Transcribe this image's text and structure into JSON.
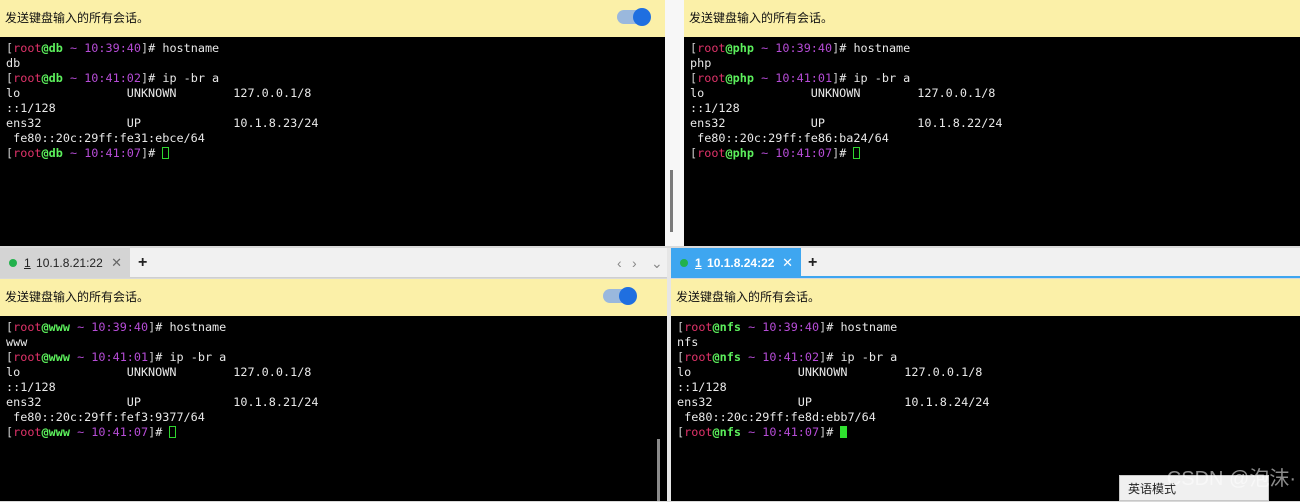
{
  "broadcast_label": "发送键盘输入的所有会话。",
  "tabs_left": {
    "num": "1",
    "label": "10.1.8.21:22",
    "close": "✕",
    "add": "+",
    "prev": "‹",
    "next": "›",
    "menu": "⌄"
  },
  "tabs_right": {
    "num": "1",
    "label": "10.1.8.24:22",
    "close": "✕",
    "add": "+"
  },
  "panes": {
    "db": {
      "host": "db",
      "t1": "10:39:40",
      "t2": "10:41:02",
      "t3": "10:41:07",
      "cmd1": "hostname",
      "out1": "db",
      "cmd2": "ip -br a",
      "lo": "lo               UNKNOWN        127.0.0.1/8",
      "lo6": "::1/128",
      "eth": "ens32            UP             10.1.8.23/24",
      "eth6": " fe80::20c:29ff:fe31:ebce/64"
    },
    "php": {
      "host": "php",
      "t1": "10:39:40",
      "t2": "10:41:01",
      "t3": "10:41:07",
      "cmd1": "hostname",
      "out1": "php",
      "cmd2": "ip -br a",
      "lo": "lo               UNKNOWN        127.0.0.1/8",
      "lo6": "::1/128",
      "eth": "ens32            UP             10.1.8.22/24",
      "eth6": " fe80::20c:29ff:fe86:ba24/64"
    },
    "www": {
      "host": "www",
      "t1": "10:39:40",
      "t2": "10:41:01",
      "t3": "10:41:07",
      "cmd1": "hostname",
      "out1": "www",
      "cmd2": "ip -br a",
      "lo": "lo               UNKNOWN        127.0.0.1/8",
      "lo6": "::1/128",
      "eth": "ens32            UP             10.1.8.21/24",
      "eth6": " fe80::20c:29ff:fef3:9377/64"
    },
    "nfs": {
      "host": "nfs",
      "t1": "10:39:40",
      "t2": "10:41:02",
      "t3": "10:41:07",
      "cmd1": "hostname",
      "out1": "nfs",
      "cmd2": "ip -br a",
      "lo": "lo               UNKNOWN        127.0.0.1/8",
      "lo6": "::1/128",
      "eth": "ens32            UP             10.1.8.24/24",
      "eth6": " fe80::20c:29ff:fe8d:ebb7/64"
    }
  },
  "prompt": {
    "user": "root",
    "at": "@",
    "tilde": "~",
    "open": "[",
    "close": "]",
    "hash": "#"
  },
  "ime_label": "英语模式",
  "watermark": "CSDN @泡沫·",
  "colors": {
    "broadcast_bg": "#fbf0a8",
    "tab_active": "#3ea6f0",
    "toggle": "#1f6fe0",
    "cursor": "#2fe02f"
  }
}
